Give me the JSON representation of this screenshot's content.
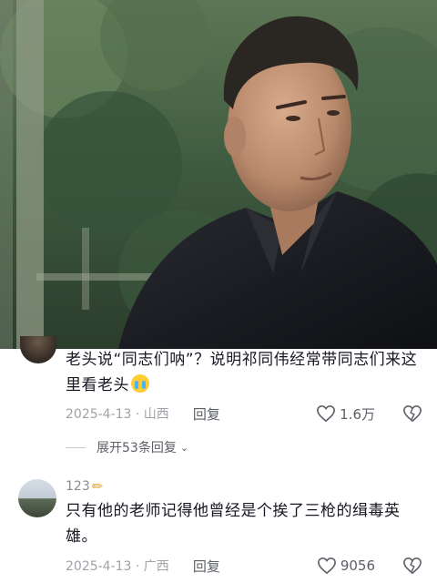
{
  "comment1": {
    "text": "老头说“同志们呐”？说明祁同伟经常带同志们来这里看老头",
    "text_line1": "老头说“同志们呐”？说明祁同伟经常带同志们来这",
    "text_line2": "里看老头",
    "emoji": "crying-emoji",
    "date": "2025-4-13",
    "location": "山西",
    "date_location": "2025-4-13 · 山西",
    "reply_label": "回复",
    "like_count": "1.6万"
  },
  "expand": {
    "label": "展开53条回复",
    "chevron": "⌄"
  },
  "comment2": {
    "username": "123",
    "username_icon": "pencil-emoji",
    "text_line1": "只有他的老师记得他曾经是个挨了三枪的缉毒英",
    "text_line2": "雄。",
    "date_location": "2025-4-13 · 广西",
    "reply_label": "回复",
    "like_count": "9056"
  },
  "colors": {
    "text_primary": "#161823",
    "text_meta": "#a0a2a8",
    "text_secondary": "#5c5f66"
  }
}
